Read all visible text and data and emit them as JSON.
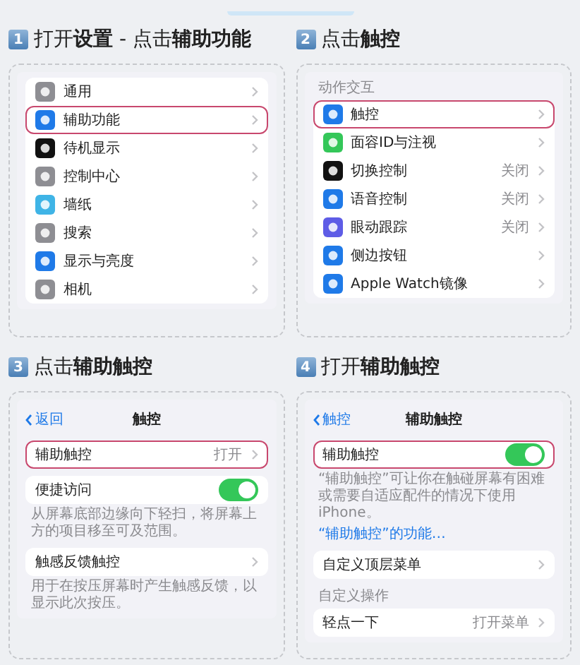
{
  "steps": [
    {
      "number": "1",
      "title": "打开**设置** - 点击**辅助功能**",
      "screen": {
        "groups": [
          {
            "rows": [
              {
                "kind": "link",
                "label": "通用",
                "color": "#8e8e93",
                "highlighted": false
              },
              {
                "kind": "link",
                "label": "辅助功能",
                "color": "#1f7ae8",
                "highlighted": true
              },
              {
                "kind": "link",
                "label": "待机显示",
                "color": "#111111",
                "highlighted": false
              },
              {
                "kind": "link",
                "label": "控制中心",
                "color": "#8e8e93",
                "highlighted": false
              },
              {
                "kind": "link",
                "label": "墙纸",
                "color": "#3fb4e6",
                "highlighted": false
              },
              {
                "kind": "link",
                "label": "搜索",
                "color": "#8e8e93",
                "highlighted": false
              },
              {
                "kind": "link",
                "label": "显示与亮度",
                "color": "#1f7ae8",
                "highlighted": false
              },
              {
                "kind": "link",
                "label": "相机",
                "color": "#8e8e93",
                "highlighted": false
              }
            ]
          }
        ]
      }
    },
    {
      "number": "2",
      "title": "点击**触控**",
      "screen": {
        "groups": [
          {
            "header": "动作交互",
            "rows": [
              {
                "kind": "link",
                "label": "触控",
                "color": "#1f7ae8",
                "highlighted": true
              },
              {
                "kind": "link",
                "label": "面容ID与注视",
                "color": "#34c759",
                "highlighted": false
              },
              {
                "kind": "link",
                "label": "切换控制",
                "value": "关闭",
                "color": "#111111",
                "highlighted": false
              },
              {
                "kind": "link",
                "label": "语音控制",
                "value": "关闭",
                "color": "#1f7ae8",
                "highlighted": false
              },
              {
                "kind": "link",
                "label": "眼动跟踪",
                "value": "关闭",
                "color": "#5e5ce6",
                "highlighted": false
              },
              {
                "kind": "link",
                "label": "侧边按钮",
                "color": "#1f7ae8",
                "highlighted": false
              },
              {
                "kind": "link",
                "label": "Apple Watch镜像",
                "color": "#1f7ae8",
                "highlighted": false
              }
            ]
          }
        ]
      }
    },
    {
      "number": "3",
      "title": "点击**辅助触控**",
      "screen": {
        "nav": {
          "back": "返回",
          "title": "触控"
        },
        "groups": [
          {
            "rows": [
              {
                "kind": "link",
                "label": "辅助触控",
                "value": "打开",
                "highlighted": true
              }
            ]
          },
          {
            "rows": [
              {
                "kind": "toggle",
                "label": "便捷访问",
                "on": true,
                "highlighted": false
              }
            ],
            "footer": "从屏幕底部边缘向下轻扫，将屏幕上方的项目移至可及范围。"
          },
          {
            "rows": [
              {
                "kind": "link",
                "label": "触感反馈触控",
                "highlighted": false
              }
            ],
            "footer": "用于在按压屏幕时产生触感反馈，以显示此次按压。"
          }
        ]
      }
    },
    {
      "number": "4",
      "title": "打开**辅助触控**",
      "screen": {
        "nav": {
          "back": "触控",
          "title": "辅助触控"
        },
        "groups": [
          {
            "rows": [
              {
                "kind": "toggle",
                "label": "辅助触控",
                "on": true,
                "highlighted": true
              }
            ],
            "footer": "“辅助触控”可让你在触碰屏幕有困难或需要自适应配件的情况下使用iPhone。",
            "footer_link": "“辅助触控”的功能…"
          },
          {
            "rows": [
              {
                "kind": "link",
                "label": "自定义顶层菜单",
                "highlighted": false
              }
            ]
          },
          {
            "header": "自定义操作",
            "rows": [
              {
                "kind": "link",
                "label": "轻点一下",
                "value": "打开菜单",
                "highlighted": false
              }
            ]
          }
        ]
      }
    }
  ]
}
